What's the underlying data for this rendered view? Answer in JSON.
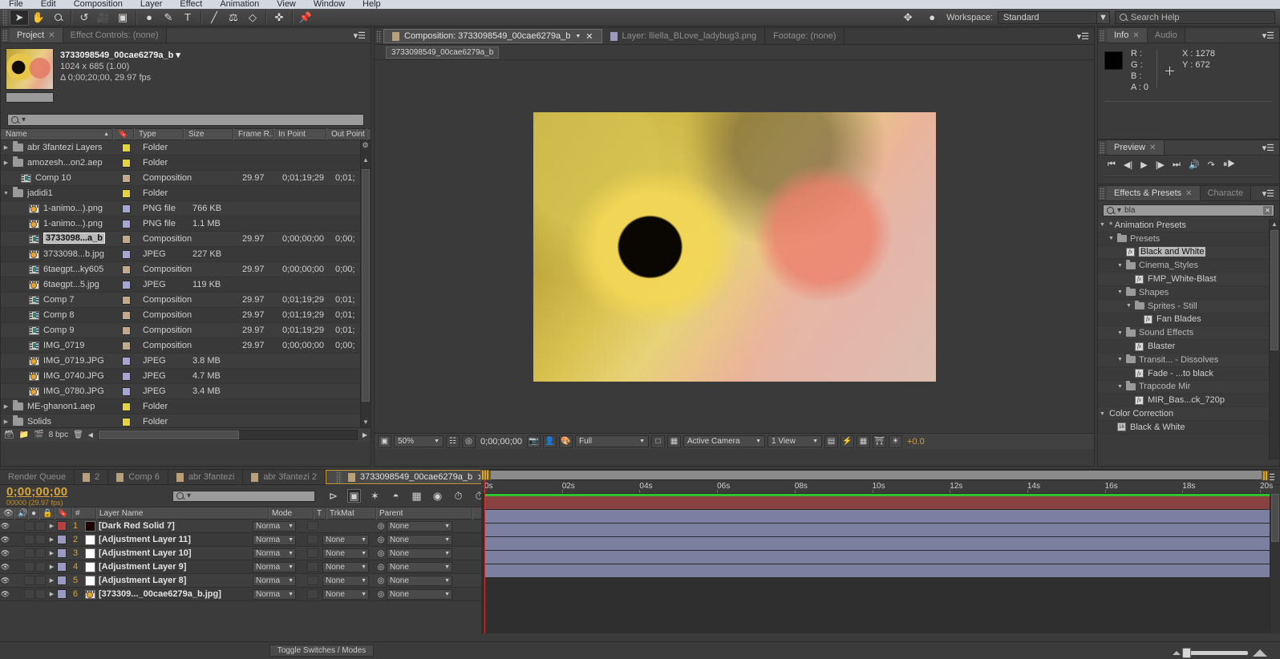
{
  "menubar": {
    "items": [
      "File",
      "Edit",
      "Composition",
      "Layer",
      "Effect",
      "Animation",
      "View",
      "Window",
      "Help"
    ]
  },
  "toolbar": {
    "workspace_label": "Workspace:",
    "workspace_value": "Standard",
    "search_help_placeholder": "Search Help",
    "tools": [
      "selection-tool",
      "hand-tool",
      "zoom-tool",
      "rotation-tool",
      "camera-tool",
      "pan-behind-tool",
      "shape-tool",
      "pen-tool",
      "type-tool",
      "brush-tool",
      "clone-stamp-tool",
      "eraser-tool",
      "roto-brush-tool",
      "puppet-pin-tool"
    ]
  },
  "project": {
    "tabs": [
      {
        "label": "Project",
        "active": true,
        "closable": true
      },
      {
        "label": "Effect Controls: (none)",
        "active": false,
        "closable": false
      }
    ],
    "header": {
      "name": "3733098549_00cae6279a_b",
      "dimensions": "1024 x 685 (1.00)",
      "duration": "Δ 0;00;20;00, 29.97 fps"
    },
    "search_placeholder": "",
    "columns": [
      "Name",
      "Type",
      "Size",
      "Frame R...",
      "In Point",
      "Out Point"
    ],
    "bit_depth": "8 bpc",
    "items": [
      {
        "name": "abr 3fantezi Layers",
        "icon": "folder",
        "label_color": "#e3d33c",
        "type": "Folder",
        "size": "",
        "frame_rate": "",
        "in_point": "",
        "out_point": "",
        "indent": 0,
        "expandable": true,
        "expanded": false,
        "selected": false
      },
      {
        "name": "amozesh...on2.aep",
        "icon": "folder",
        "label_color": "#e3d33c",
        "type": "Folder",
        "size": "",
        "frame_rate": "",
        "in_point": "",
        "out_point": "",
        "indent": 0,
        "expandable": true,
        "expanded": false,
        "selected": false
      },
      {
        "name": "Comp 10",
        "icon": "composition",
        "label_color": "#c2a98b",
        "type": "Composition",
        "size": "",
        "frame_rate": "29.97",
        "in_point": "0;01;19;29",
        "out_point": "0;01;",
        "indent": 1,
        "expandable": false,
        "expanded": false,
        "selected": false
      },
      {
        "name": "jadidi1",
        "icon": "folder",
        "label_color": "#e3d33c",
        "type": "Folder",
        "size": "",
        "frame_rate": "",
        "in_point": "",
        "out_point": "",
        "indent": 0,
        "expandable": true,
        "expanded": true,
        "selected": false
      },
      {
        "name": "1-animo...).png",
        "icon": "image",
        "label_color": "#a6a6d6",
        "type": "PNG file",
        "size": "766 KB",
        "frame_rate": "",
        "in_point": "",
        "out_point": "",
        "indent": 2,
        "expandable": false,
        "expanded": false,
        "selected": false
      },
      {
        "name": "1-animo...).png",
        "icon": "image",
        "label_color": "#a6a6d6",
        "type": "PNG file",
        "size": "1.1 MB",
        "frame_rate": "",
        "in_point": "",
        "out_point": "",
        "indent": 2,
        "expandable": false,
        "expanded": false,
        "selected": false
      },
      {
        "name": "3733098...a_b",
        "icon": "composition",
        "label_color": "#c2a98b",
        "type": "Composition",
        "size": "",
        "frame_rate": "29.97",
        "in_point": "0;00;00;00",
        "out_point": "0;00;",
        "indent": 2,
        "expandable": false,
        "expanded": false,
        "selected": true
      },
      {
        "name": "3733098...b.jpg",
        "icon": "image",
        "label_color": "#a6a6d6",
        "type": "JPEG",
        "size": "227 KB",
        "frame_rate": "",
        "in_point": "",
        "out_point": "",
        "indent": 2,
        "expandable": false,
        "expanded": false,
        "selected": false
      },
      {
        "name": "6taegpt...ky605",
        "icon": "composition",
        "label_color": "#c2a98b",
        "type": "Composition",
        "size": "",
        "frame_rate": "29.97",
        "in_point": "0;00;00;00",
        "out_point": "0;00;",
        "indent": 2,
        "expandable": false,
        "expanded": false,
        "selected": false
      },
      {
        "name": "6taegpt...5.jpg",
        "icon": "image",
        "label_color": "#a6a6d6",
        "type": "JPEG",
        "size": "119 KB",
        "frame_rate": "",
        "in_point": "",
        "out_point": "",
        "indent": 2,
        "expandable": false,
        "expanded": false,
        "selected": false
      },
      {
        "name": "Comp 7",
        "icon": "composition",
        "label_color": "#c2a98b",
        "type": "Composition",
        "size": "",
        "frame_rate": "29.97",
        "in_point": "0;01;19;29",
        "out_point": "0;01;",
        "indent": 2,
        "expandable": false,
        "expanded": false,
        "selected": false
      },
      {
        "name": "Comp 8",
        "icon": "composition",
        "label_color": "#c2a98b",
        "type": "Composition",
        "size": "",
        "frame_rate": "29.97",
        "in_point": "0;01;19;29",
        "out_point": "0;01;",
        "indent": 2,
        "expandable": false,
        "expanded": false,
        "selected": false
      },
      {
        "name": "Comp 9",
        "icon": "composition",
        "label_color": "#c2a98b",
        "type": "Composition",
        "size": "",
        "frame_rate": "29.97",
        "in_point": "0;01;19;29",
        "out_point": "0;01;",
        "indent": 2,
        "expandable": false,
        "expanded": false,
        "selected": false
      },
      {
        "name": "IMG_0719",
        "icon": "composition",
        "label_color": "#c2a98b",
        "type": "Composition",
        "size": "",
        "frame_rate": "29.97",
        "in_point": "0;00;00;00",
        "out_point": "0;00;",
        "indent": 2,
        "expandable": false,
        "expanded": false,
        "selected": false
      },
      {
        "name": "IMG_0719.JPG",
        "icon": "image",
        "label_color": "#a6a6d6",
        "type": "JPEG",
        "size": "3.8 MB",
        "frame_rate": "",
        "in_point": "",
        "out_point": "",
        "indent": 2,
        "expandable": false,
        "expanded": false,
        "selected": false
      },
      {
        "name": "IMG_0740.JPG",
        "icon": "image",
        "label_color": "#a6a6d6",
        "type": "JPEG",
        "size": "4.7 MB",
        "frame_rate": "",
        "in_point": "",
        "out_point": "",
        "indent": 2,
        "expandable": false,
        "expanded": false,
        "selected": false
      },
      {
        "name": "IMG_0780.JPG",
        "icon": "image",
        "label_color": "#a6a6d6",
        "type": "JPEG",
        "size": "3.4 MB",
        "frame_rate": "",
        "in_point": "",
        "out_point": "",
        "indent": 2,
        "expandable": false,
        "expanded": false,
        "selected": false
      },
      {
        "name": "ME-ghanon1.aep",
        "icon": "folder",
        "label_color": "#e3d33c",
        "type": "Folder",
        "size": "",
        "frame_rate": "",
        "in_point": "",
        "out_point": "",
        "indent": 0,
        "expandable": true,
        "expanded": false,
        "selected": false
      },
      {
        "name": "Solids",
        "icon": "folder",
        "label_color": "#e3d33c",
        "type": "Folder",
        "size": "",
        "frame_rate": "",
        "in_point": "",
        "out_point": "",
        "indent": 0,
        "expandable": true,
        "expanded": false,
        "selected": false
      }
    ]
  },
  "viewer": {
    "tabs": [
      {
        "label": "Composition: 3733098549_00cae6279a_b",
        "active": true,
        "swatch": "#b8a07a"
      },
      {
        "label": "Layer: lliella_BLove_ladybug3.png",
        "active": false,
        "swatch": "#9a9ac0"
      },
      {
        "label": "Footage: (none)",
        "active": false,
        "swatch": ""
      }
    ],
    "breadcrumb": "3733098549_00cae6279a_b",
    "controls": {
      "magnification": "50%",
      "timecode": "0;00;00;00",
      "resolution": "Full",
      "camera": "Active Camera",
      "views": "1 View",
      "exposure": "+0.0"
    }
  },
  "info": {
    "tabs": [
      {
        "label": "Info",
        "active": true
      },
      {
        "label": "Audio",
        "active": false
      }
    ],
    "r_label": "R :",
    "g_label": "G :",
    "b_label": "B :",
    "a_label": "A :",
    "r_value": "",
    "g_value": "",
    "b_value": "",
    "a_value": "0",
    "x_label": "X :",
    "x_value": "1278",
    "y_label": "Y :",
    "y_value": "672"
  },
  "preview": {
    "tabs": [
      {
        "label": "Preview",
        "active": true
      }
    ],
    "buttons": [
      "first-frame",
      "previous-frame",
      "play",
      "next-frame",
      "last-frame",
      "audio-toggle",
      "loop",
      "ram-preview"
    ]
  },
  "effects": {
    "tabs": [
      {
        "label": "Effects & Presets",
        "active": true
      },
      {
        "label": "Characte",
        "active": false
      }
    ],
    "search_value": "bla",
    "items": [
      {
        "label": "* Animation Presets",
        "icon": "twirl",
        "indent": 0,
        "kind": "root",
        "highlighted": false
      },
      {
        "label": "Presets",
        "icon": "folder",
        "indent": 1,
        "kind": "folder",
        "highlighted": false
      },
      {
        "label": "Black and White",
        "icon": "preset",
        "indent": 2,
        "kind": "preset",
        "highlighted": true
      },
      {
        "label": "Cinema_Styles",
        "icon": "folder",
        "indent": 2,
        "kind": "folder",
        "highlighted": false
      },
      {
        "label": "FMP_White-Blast",
        "icon": "preset",
        "indent": 3,
        "kind": "preset",
        "highlighted": false
      },
      {
        "label": "Shapes",
        "icon": "folder",
        "indent": 2,
        "kind": "folder",
        "highlighted": false
      },
      {
        "label": "Sprites - Still",
        "icon": "folder",
        "indent": 3,
        "kind": "folder",
        "highlighted": false
      },
      {
        "label": "Fan Blades",
        "icon": "preset",
        "indent": 4,
        "kind": "preset",
        "highlighted": false
      },
      {
        "label": "Sound Effects",
        "icon": "folder",
        "indent": 2,
        "kind": "folder",
        "highlighted": false
      },
      {
        "label": "Blaster",
        "icon": "preset",
        "indent": 3,
        "kind": "preset",
        "highlighted": false
      },
      {
        "label": "Transit... - Dissolves",
        "icon": "folder",
        "indent": 2,
        "kind": "folder",
        "highlighted": false
      },
      {
        "label": "Fade - ...to black",
        "icon": "preset",
        "indent": 3,
        "kind": "preset",
        "highlighted": false
      },
      {
        "label": "Trapcode Mir",
        "icon": "folder",
        "indent": 2,
        "kind": "folder",
        "highlighted": false
      },
      {
        "label": "MIR_Bas...ck_720p",
        "icon": "preset",
        "indent": 3,
        "kind": "preset",
        "highlighted": false
      },
      {
        "label": "Color Correction",
        "icon": "twirl",
        "indent": 0,
        "kind": "root",
        "highlighted": false
      },
      {
        "label": "Black & White",
        "icon": "effect",
        "indent": 1,
        "kind": "effect",
        "highlighted": false
      }
    ]
  },
  "timeline": {
    "tabs": [
      {
        "label": "Render Queue",
        "active": false,
        "swatch": ""
      },
      {
        "label": "2",
        "active": false,
        "swatch": "#b8a07a"
      },
      {
        "label": "Comp 6",
        "active": false,
        "swatch": "#b8a07a"
      },
      {
        "label": "abr 3fantezi",
        "active": false,
        "swatch": "#b8a07a"
      },
      {
        "label": "abr 3fantezi 2",
        "active": false,
        "swatch": "#b8a07a"
      },
      {
        "label": "3733098549_00cae6279a_b",
        "active": true,
        "swatch": "#b8a07a"
      }
    ],
    "current_time": "0;00;00;00",
    "frame_info": "00000 (29.97 fps)",
    "search_placeholder": "",
    "columns": [
      "#",
      "Layer Name",
      "Mode",
      "T",
      "TrkMat",
      "Parent"
    ],
    "toggle_switches_label": "Toggle Switches / Modes",
    "ruler_ticks": [
      "0s",
      "02s",
      "04s",
      "06s",
      "08s",
      "10s",
      "12s",
      "14s",
      "16s",
      "18s",
      "20s"
    ],
    "layers": [
      {
        "num": "1",
        "name": "[Dark Red Solid 7]",
        "mode": "Norma",
        "trkmat": "",
        "parent": "None",
        "label_color": "#b54242",
        "source_color": "#1a0404",
        "bar_color": "#8a4141",
        "has_trkmat": false,
        "source_icon": "solid"
      },
      {
        "num": "2",
        "name": "[Adjustment Layer 11]",
        "mode": "Norma",
        "trkmat": "None",
        "parent": "None",
        "label_color": "#9a9ac0",
        "source_color": "#ffffff",
        "bar_color": "#7b7fa0",
        "has_trkmat": true,
        "source_icon": "solid"
      },
      {
        "num": "3",
        "name": "[Adjustment Layer 10]",
        "mode": "Norma",
        "trkmat": "None",
        "parent": "None",
        "label_color": "#9a9ac0",
        "source_color": "#ffffff",
        "bar_color": "#7b7fa0",
        "has_trkmat": true,
        "source_icon": "solid"
      },
      {
        "num": "4",
        "name": "[Adjustment Layer 9]",
        "mode": "Norma",
        "trkmat": "None",
        "parent": "None",
        "label_color": "#9a9ac0",
        "source_color": "#ffffff",
        "bar_color": "#7b7fa0",
        "has_trkmat": true,
        "source_icon": "solid"
      },
      {
        "num": "5",
        "name": "[Adjustment Layer 8]",
        "mode": "Norma",
        "trkmat": "None",
        "parent": "None",
        "label_color": "#9a9ac0",
        "source_color": "#ffffff",
        "bar_color": "#7b7fa0",
        "has_trkmat": true,
        "source_icon": "solid"
      },
      {
        "num": "6",
        "name": "[373309..._00cae6279a_b.jpg]",
        "mode": "Norma",
        "trkmat": "None",
        "parent": "None",
        "label_color": "#9a9ac0",
        "source_color": "",
        "bar_color": "#7b7fa0",
        "has_trkmat": true,
        "source_icon": "image"
      }
    ]
  }
}
